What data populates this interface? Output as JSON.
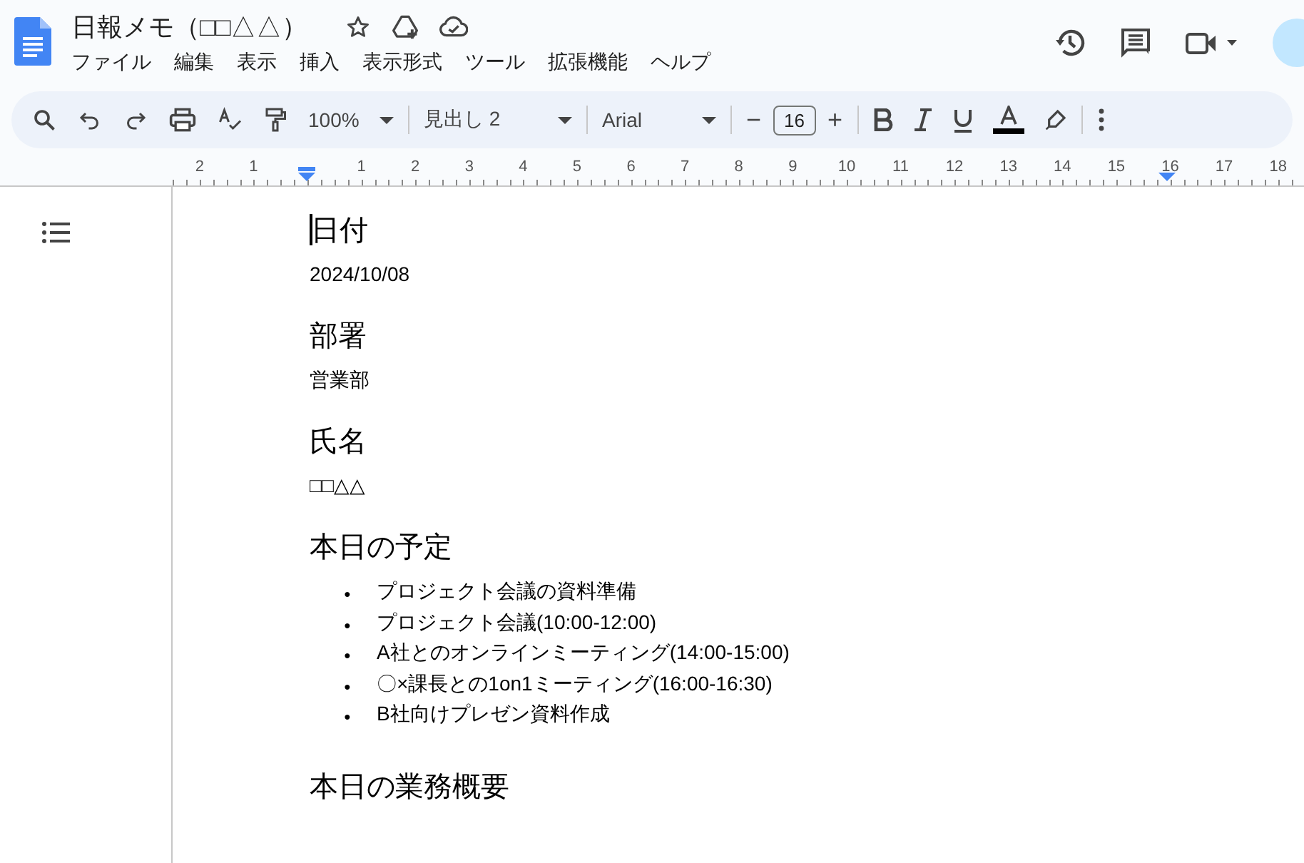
{
  "header": {
    "title": "日報メモ（□□△△）",
    "menu": [
      "ファイル",
      "編集",
      "表示",
      "挿入",
      "表示形式",
      "ツール",
      "拡張機能",
      "ヘルプ"
    ]
  },
  "toolbar": {
    "zoom": "100%",
    "style": "見出し 2",
    "font": "Arial",
    "font_size": "16",
    "minus": "−",
    "plus": "+"
  },
  "ruler": {
    "left_labels": [
      "2",
      "1"
    ],
    "right_labels": [
      "1",
      "2",
      "3",
      "4",
      "5",
      "6",
      "7",
      "8",
      "9",
      "10",
      "11",
      "12",
      "13",
      "14",
      "15",
      "16",
      "17",
      "18"
    ]
  },
  "document": {
    "blocks": [
      {
        "kind": "heading",
        "text": "日付",
        "cursor": true
      },
      {
        "kind": "paragraph",
        "text": "2024/10/08",
        "cursor": false
      },
      {
        "kind": "heading",
        "text": "部署",
        "cursor": false
      },
      {
        "kind": "paragraph",
        "text": "営業部",
        "cursor": false
      },
      {
        "kind": "heading",
        "text": "氏名",
        "cursor": false
      },
      {
        "kind": "paragraph",
        "text": "□□△△",
        "cursor": false
      },
      {
        "kind": "heading",
        "text": "本日の予定",
        "cursor": false
      },
      {
        "kind": "list",
        "cursor": false,
        "bullet": "●",
        "items": [
          "プロジェクト会議の資料準備",
          "プロジェクト会議(10:00-12:00)",
          "A社とのオンラインミーティング(14:00-15:00)",
          "〇×課長との1on1ミーティング(16:00-16:30)",
          "B社向けプレゼン資料作成"
        ]
      },
      {
        "kind": "heading",
        "text": "本日の業務概要",
        "cursor": false
      }
    ]
  }
}
